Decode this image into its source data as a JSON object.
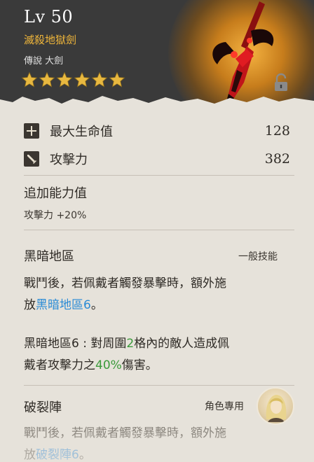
{
  "header": {
    "level": "Lv 50",
    "weapon_name": "滅殺地獄劍",
    "weapon_type": "傳說  大劍",
    "stars": 6,
    "locked": true
  },
  "stats": [
    {
      "label": "最大生命值",
      "value": "128",
      "icon": "plus-icon"
    },
    {
      "label": "攻擊力",
      "value": "382",
      "icon": "sword-icon"
    }
  ],
  "bonus": {
    "title": "追加能力值",
    "line": "攻擊力 +20%"
  },
  "skill1": {
    "title": "黑暗地區",
    "tag": "一般技能",
    "desc_line1": "戰鬥後，若佩戴者觸發暴擊時，額外施",
    "desc_prefix": "放",
    "desc_link": "黑暗地區6",
    "desc_suffix": "。",
    "detail_line1_prefix": "黑暗地區6 : 對周圍",
    "detail_line1_num": "2",
    "detail_line1_suffix": "格內的敵人造成佩",
    "detail_line2_prefix": "戴者攻擊力之",
    "detail_line2_pct": "40%",
    "detail_line2_suffix": "傷害。"
  },
  "skill2": {
    "title": "破裂陣",
    "tag": "角色專用",
    "desc_line1": "戰鬥後，若佩戴者觸發暴擊時，額外施",
    "desc_prefix": "放",
    "desc_link": "破裂陣6",
    "desc_suffix": "。"
  },
  "colors": {
    "gold": "#f0b63a",
    "link_blue": "#2a8bd6",
    "highlight_green": "#3a9a3a",
    "text_dark": "#2e2a25"
  }
}
